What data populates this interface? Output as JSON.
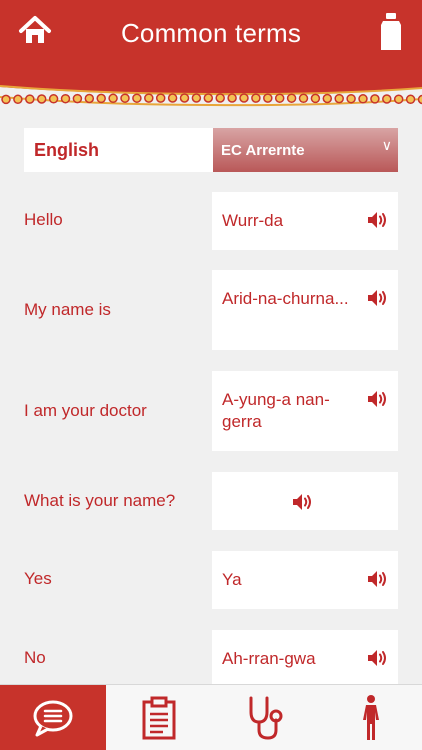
{
  "header": {
    "title": "Common terms"
  },
  "language_bar": {
    "source": "English",
    "target": "EC Arrernte"
  },
  "terms": [
    {
      "english": "Hello",
      "translation": "Wurr-da"
    },
    {
      "english": "My name is",
      "translation": "Arid-na-churna..."
    },
    {
      "english": "I am your doctor",
      "translation": "A-yung-a nan-gerra"
    },
    {
      "english": "What is your name?",
      "translation": ""
    },
    {
      "english": "Yes",
      "translation": "Ya"
    },
    {
      "english": "No",
      "translation": "Ah-rran-gwa"
    }
  ],
  "tabs": [
    {
      "icon": "chat-bubble-icon",
      "active": true
    },
    {
      "icon": "clipboard-icon",
      "active": false
    },
    {
      "icon": "stethoscope-icon",
      "active": false
    },
    {
      "icon": "body-figure-icon",
      "active": false
    }
  ],
  "colors": {
    "brand_red": "#c7332b",
    "text_red": "#c0282a",
    "background": "#f0f0f0"
  }
}
